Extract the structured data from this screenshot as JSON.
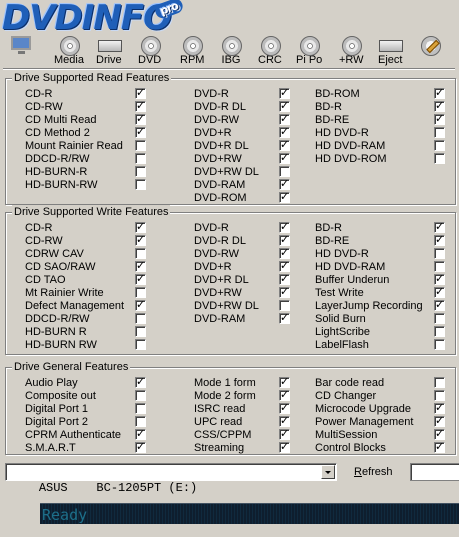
{
  "app": {
    "logo_text": "DVDINFO",
    "logo_badge": "pro"
  },
  "toolbar": [
    {
      "label": "",
      "icon": "monitor-icon"
    },
    {
      "label": "Media",
      "icon": "disc-icon"
    },
    {
      "label": "Drive",
      "icon": "drive-icon"
    },
    {
      "label": "DVD",
      "icon": "disc-icon"
    },
    {
      "label": "RPM",
      "icon": "disc-icon"
    },
    {
      "label": "IBG",
      "icon": "disc-icon"
    },
    {
      "label": "CRC",
      "icon": "disc-icon"
    },
    {
      "label": "Pi Po",
      "icon": "disc-icon"
    },
    {
      "label": "+RW",
      "icon": "disc-icon"
    },
    {
      "label": "Eject",
      "icon": "eject-drive-icon"
    },
    {
      "label": "",
      "icon": "pen-disc-icon"
    }
  ],
  "groups": {
    "read": {
      "title": "Drive Supported Read Features",
      "columns": [
        [
          {
            "label": "CD-R",
            "checked": true
          },
          {
            "label": "CD-RW",
            "checked": true
          },
          {
            "label": "CD Multi Read",
            "checked": true
          },
          {
            "label": "CD Method 2",
            "checked": true
          },
          {
            "label": "Mount Rainier Read",
            "checked": false
          },
          {
            "label": "DDCD-R/RW",
            "checked": false
          },
          {
            "label": "HD-BURN-R",
            "checked": false
          },
          {
            "label": "HD-BURN-RW",
            "checked": false
          }
        ],
        [
          {
            "label": "DVD-R",
            "checked": true
          },
          {
            "label": "DVD-R DL",
            "checked": true
          },
          {
            "label": "DVD-RW",
            "checked": true
          },
          {
            "label": "DVD+R",
            "checked": true
          },
          {
            "label": "DVD+R DL",
            "checked": true
          },
          {
            "label": "DVD+RW",
            "checked": true
          },
          {
            "label": "DVD+RW DL",
            "checked": false
          },
          {
            "label": "DVD-RAM",
            "checked": true
          },
          {
            "label": "DVD-ROM",
            "checked": true
          }
        ],
        [
          {
            "label": "BD-ROM",
            "checked": true
          },
          {
            "label": "BD-R",
            "checked": true
          },
          {
            "label": "BD-RE",
            "checked": true
          },
          {
            "label": "HD DVD-R",
            "checked": false
          },
          {
            "label": "HD DVD-RAM",
            "checked": false
          },
          {
            "label": "HD DVD-ROM",
            "checked": false
          }
        ]
      ]
    },
    "write": {
      "title": "Drive Supported Write Features",
      "columns": [
        [
          {
            "label": "CD-R",
            "checked": true
          },
          {
            "label": "CD-RW",
            "checked": true
          },
          {
            "label": "CDRW CAV",
            "checked": false
          },
          {
            "label": "CD SAO/RAW",
            "checked": true
          },
          {
            "label": "CD TAO",
            "checked": true
          },
          {
            "label": "Mt Rainier Write",
            "checked": false
          },
          {
            "label": "Defect Management",
            "checked": true
          },
          {
            "label": "DDCD-R/RW",
            "checked": false
          },
          {
            "label": "HD-BURN R",
            "checked": false
          },
          {
            "label": "HD-BURN RW",
            "checked": false
          }
        ],
        [
          {
            "label": "DVD-R",
            "checked": true
          },
          {
            "label": "DVD-R DL",
            "checked": true
          },
          {
            "label": "DVD-RW",
            "checked": true
          },
          {
            "label": "DVD+R",
            "checked": true
          },
          {
            "label": "DVD+R DL",
            "checked": true
          },
          {
            "label": "DVD+RW",
            "checked": true
          },
          {
            "label": "DVD+RW DL",
            "checked": false
          },
          {
            "label": "DVD-RAM",
            "checked": true
          }
        ],
        [
          {
            "label": "BD-R",
            "checked": true
          },
          {
            "label": "BD-RE",
            "checked": true
          },
          {
            "label": "HD DVD-R",
            "checked": false
          },
          {
            "label": "HD DVD-RAM",
            "checked": false
          },
          {
            "label": "Buffer Underun",
            "checked": true
          },
          {
            "label": "Test Write",
            "checked": true
          },
          {
            "label": "LayerJump Recording",
            "checked": true
          },
          {
            "label": "Solid Burn",
            "checked": false
          },
          {
            "label": "LightScribe",
            "checked": false
          },
          {
            "label": "LabelFlash",
            "checked": false
          }
        ]
      ]
    },
    "general": {
      "title": "Drive General Features",
      "columns": [
        [
          {
            "label": "Audio Play",
            "checked": true
          },
          {
            "label": "Composite out",
            "checked": false
          },
          {
            "label": "Digital Port 1",
            "checked": false
          },
          {
            "label": "Digital Port 2",
            "checked": false
          },
          {
            "label": "CPRM Authenticate",
            "checked": true
          },
          {
            "label": "S.M.A.R.T",
            "checked": true
          }
        ],
        [
          {
            "label": "Mode 1 form",
            "checked": true
          },
          {
            "label": "Mode 2 form",
            "checked": true
          },
          {
            "label": "ISRC read",
            "checked": true
          },
          {
            "label": "UPC read",
            "checked": true
          },
          {
            "label": "CSS/CPPM",
            "checked": true
          },
          {
            "label": "Streaming",
            "checked": true
          }
        ],
        [
          {
            "label": "Bar code read",
            "checked": false
          },
          {
            "label": "CD Changer",
            "checked": false
          },
          {
            "label": "Microcode Upgrade",
            "checked": true
          },
          {
            "label": "Power Management",
            "checked": true
          },
          {
            "label": "MultiSession",
            "checked": true
          },
          {
            "label": "Control Blocks",
            "checked": true
          }
        ]
      ]
    }
  },
  "footer": {
    "drive_select_value": "ASUS    BC-1205PT (E:)",
    "refresh_label_u": "R",
    "refresh_label_rest": "efresh",
    "status_text": "Ready"
  }
}
